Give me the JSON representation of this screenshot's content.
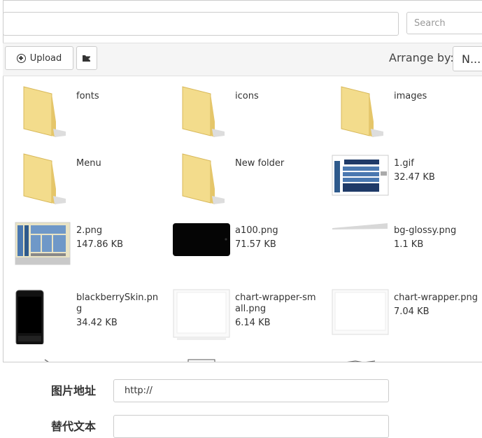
{
  "search": {
    "placeholder": "Search"
  },
  "toolbar": {
    "upload_label": "Upload",
    "arrange_label": "Arrange by:",
    "arrange_value": "N..."
  },
  "files": [
    {
      "name": "fonts",
      "size": "",
      "kind": "folder"
    },
    {
      "name": "icons",
      "size": "",
      "kind": "folder"
    },
    {
      "name": "images",
      "size": "",
      "kind": "folder"
    },
    {
      "name": "Menu",
      "size": "",
      "kind": "folder"
    },
    {
      "name": "New folder",
      "size": "",
      "kind": "folder"
    },
    {
      "name": "1.gif",
      "size": "32.47 KB",
      "kind": "image"
    },
    {
      "name": "2.png",
      "size": "147.86 KB",
      "kind": "image"
    },
    {
      "name": "a100.png",
      "size": "71.57 KB",
      "kind": "image"
    },
    {
      "name": "bg-glossy.png",
      "size": "1.1 KB",
      "kind": "image"
    },
    {
      "name": "blackberrySkin.png",
      "size": "34.42 KB",
      "kind": "image"
    },
    {
      "name": "chart-wrapper-small.png",
      "size": "6.14 KB",
      "kind": "image"
    },
    {
      "name": "chart-wrapper.png",
      "size": "7.04 KB",
      "kind": "image"
    }
  ],
  "form": {
    "image_url_label": "图片地址",
    "image_url_value": "http://",
    "alt_text_label": "替代文本",
    "alt_text_value": ""
  }
}
